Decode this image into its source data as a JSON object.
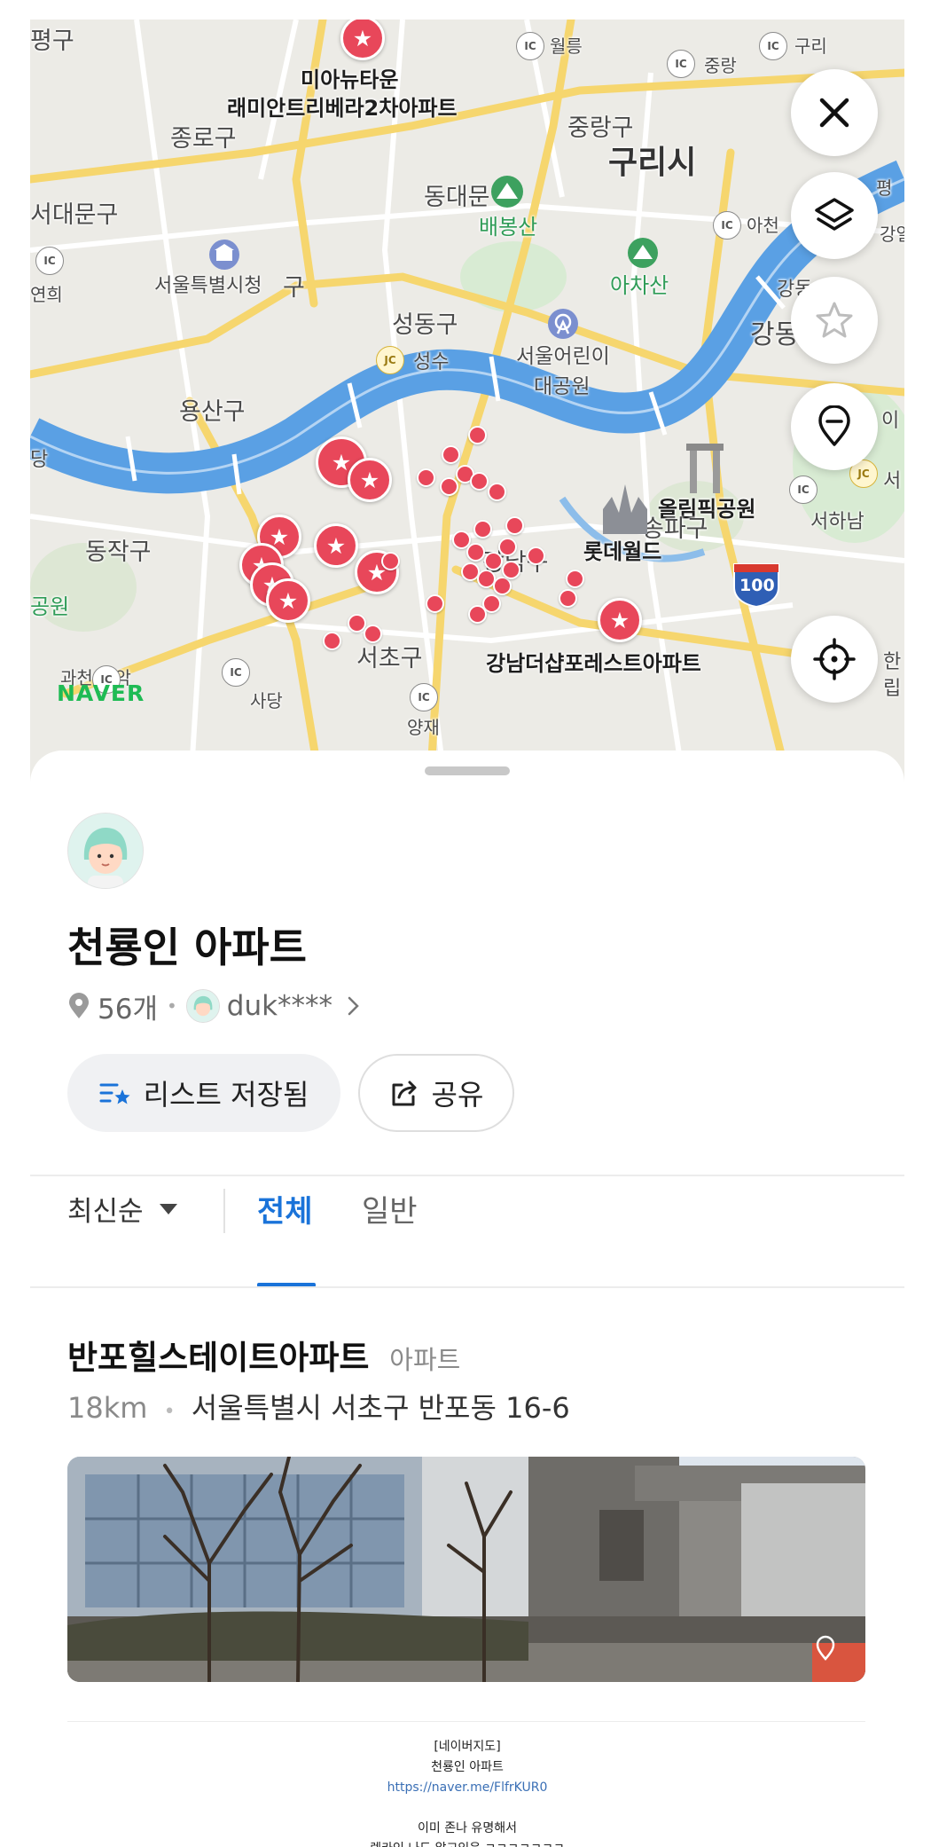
{
  "map": {
    "brand": "NAVER",
    "districts": [
      "평구",
      "종로구",
      "서대문구",
      "용산구",
      "동작구",
      "성동구",
      "중랑구",
      "구리시",
      "동대문구",
      "강동",
      "서초구",
      "서하남"
    ],
    "labels": {
      "miatown": "미아뉴타운",
      "remian": "래미안트리베라2차아파트",
      "jongno": "종로구",
      "seodaemun": "서대문구",
      "cityhall": "서울특별시청",
      "junggu": "구",
      "yonhui": "연희",
      "yongsan": "용산구",
      "dang": "당",
      "dongjak": "동작구",
      "gongwon": "공원",
      "gwacheon": "과천 과악",
      "sadang": "사당",
      "seocho": "서초구",
      "yangjae": "양재",
      "seongdong": "성동구",
      "seongsu": "성수",
      "childpark1": "서울어린이",
      "childpark2": "대공원",
      "jungnang": "중랑구",
      "guri": "구리시",
      "dongdaemun": "동대문",
      "baebongsan": "배봉산",
      "achasan": "아차산",
      "gangdong": "강동",
      "gangdong2": "강동",
      "olympic": "올림픽공원",
      "lotteworld": "롯데월드",
      "songpa": "송파구",
      "gangnam": "강남구",
      "seohanam": "서하남",
      "gangnam_forest": "강남더샵포레스트아파트",
      "wollung": "월릉",
      "jungang": "중랑",
      "guri_ic": "구리",
      "achon": "아천",
      "highway": "100",
      "right1": "평",
      "right2": "강일",
      "right3": "이",
      "right4": "서",
      "right5": "한",
      "right6": "립"
    },
    "ic_labels": {
      "ic": "IC",
      "jc": "JC"
    }
  },
  "list": {
    "title": "천룡인 아파트",
    "count": "56개",
    "owner": "duk****",
    "saved_label": "리스트 저장됨",
    "share_label": "공유"
  },
  "filter": {
    "sort_label": "최신순",
    "tabs": [
      {
        "label": "전체",
        "active": true
      },
      {
        "label": "일반",
        "active": false
      }
    ]
  },
  "places": [
    {
      "name": "반포힐스테이트아파트",
      "category": "아파트",
      "distance": "18km",
      "address": "서울특별시 서초구 반포동 16-6"
    }
  ],
  "footer": {
    "line1": "[네이버지도]",
    "line2": "천룡인 아파트",
    "link": "https://naver.me/FlfrKUR0",
    "line4": "이미 존나 유명해서",
    "line5": "렉카인 나도 알고있음 ㅋㅋㅋㅋㅋㅋㅋ"
  },
  "colors": {
    "accent": "#1a73d9",
    "pin": "#e8475a",
    "river": "#5aa0e4",
    "naver": "#1fbb54"
  }
}
